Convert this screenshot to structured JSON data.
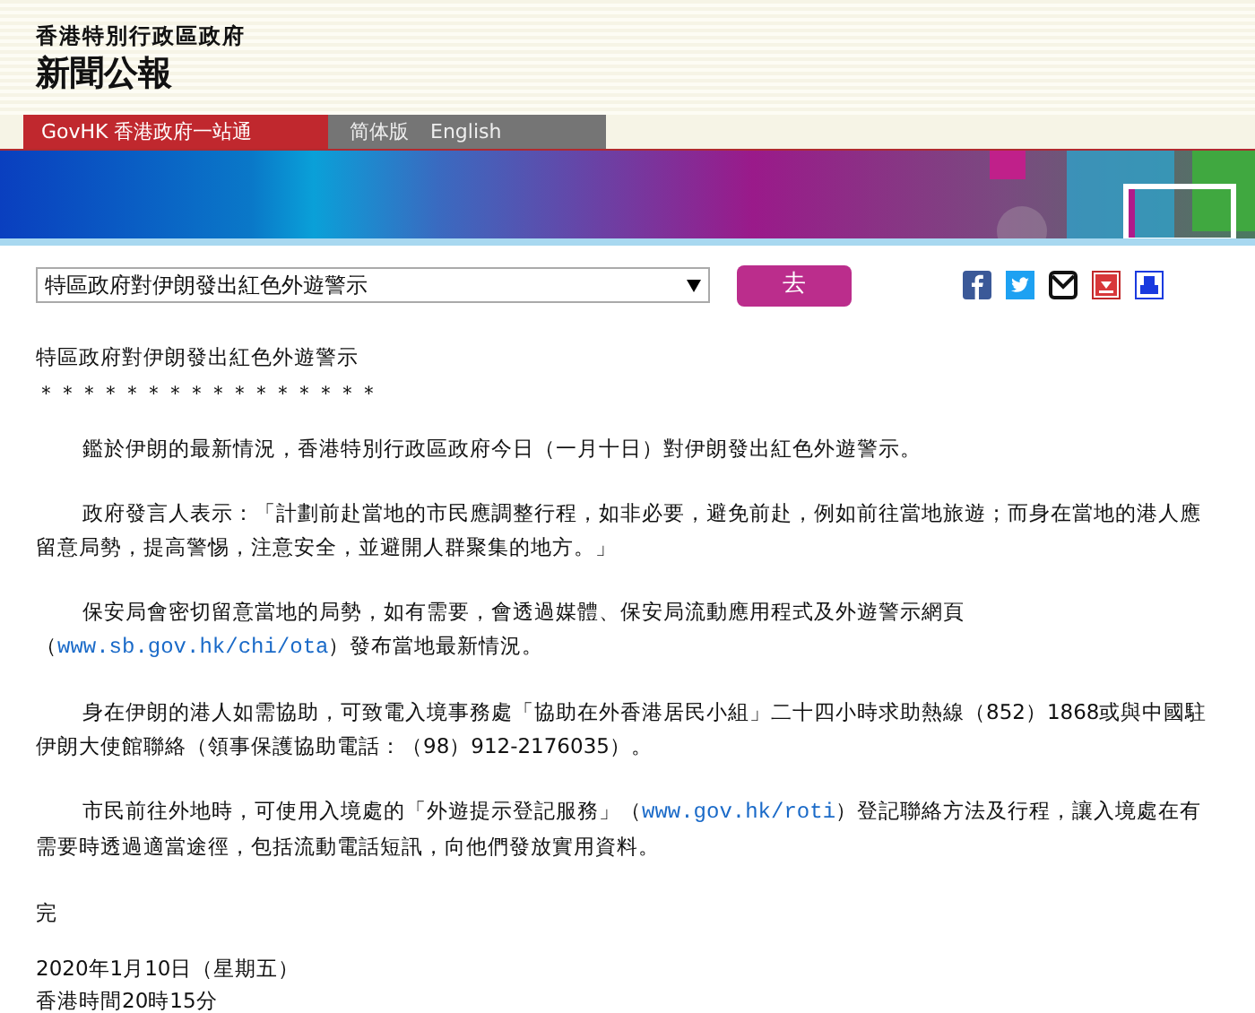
{
  "header": {
    "government": "香港特別行政區政府",
    "title": "新聞公報"
  },
  "nav": [
    {
      "label": "GovHK 香港政府一站通",
      "selected": true
    },
    {
      "label": "简体版",
      "selected": false
    },
    {
      "label": "English",
      "selected": false
    }
  ],
  "toolbar": {
    "selector": "特區政府對伊朗發出紅色外遊警示",
    "go_button": "去"
  },
  "article": {
    "title": "特區政府對伊朗發出紅色外遊警示",
    "separator": "＊＊＊＊＊＊＊＊＊＊＊＊＊＊＊＊",
    "paragraphs": [
      [
        {
          "kind": "text",
          "text": "鑑於伊朗的最新情況，香港特別行政區政府今日（一月十日）對伊朗發出紅色外遊警示。"
        }
      ],
      [
        {
          "kind": "text",
          "text": "政府發言人表示：「計劃前赴當地的市民應調整行程，如非必要，避免前赴，例如前往當地旅遊；而身在當地的港人應留意局勢，提高警惕，注意安全，並避開人群聚集的地方。」"
        }
      ],
      [
        {
          "kind": "text",
          "text": "保安局會密切留意當地的局勢，如有需要，會透過媒體、保安局流動應用程式及外遊警示網頁（"
        },
        {
          "kind": "link",
          "text": "www.sb.gov.hk/chi/ota"
        },
        {
          "kind": "text",
          "text": "）發布當地最新情況。"
        }
      ],
      [
        {
          "kind": "text",
          "text": "身在伊朗的港人如需協助，可致電入境事務處「協助在外香港居民小組」二十四小時求助熱線（852）1868或與中國駐伊朗大使館聯絡（領事保護協助電話：（98）912-2176035）。"
        }
      ],
      [
        {
          "kind": "text",
          "text": "市民前往外地時，可使用入境處的「外遊提示登記服務」（"
        },
        {
          "kind": "link",
          "text": "www.gov.hk/roti"
        },
        {
          "kind": "text",
          "text": "）登記聯絡方法及行程，讓入境處在有需要時透過適當途徑，包括流動電話短訊，向他們發放實用資料。"
        }
      ]
    ],
    "end": "完",
    "date": "2020年1月10日（星期五）",
    "time": "香港時間20時15分"
  }
}
